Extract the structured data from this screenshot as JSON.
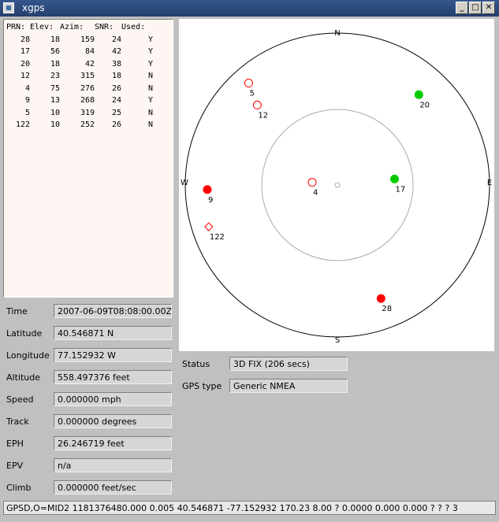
{
  "window": {
    "title": "xgps",
    "minimize_glyph": "_",
    "maximize_glyph": "□",
    "close_glyph": "✕"
  },
  "satellite_table": {
    "headers": [
      "PRN:",
      "Elev:",
      "Azim:",
      "SNR:",
      "Used:"
    ],
    "rows": [
      [
        "28",
        "18",
        "159",
        "24",
        "Y"
      ],
      [
        "17",
        "56",
        "84",
        "42",
        "Y"
      ],
      [
        "20",
        "18",
        "42",
        "38",
        "Y"
      ],
      [
        "12",
        "23",
        "315",
        "18",
        "N"
      ],
      [
        "4",
        "75",
        "276",
        "26",
        "N"
      ],
      [
        "9",
        "13",
        "268",
        "24",
        "Y"
      ],
      [
        "5",
        "10",
        "319",
        "25",
        "N"
      ],
      [
        "122",
        "10",
        "252",
        "26",
        "N"
      ]
    ]
  },
  "skyview": {
    "compass": {
      "north": "N",
      "south": "S",
      "east": "E",
      "west": "W"
    },
    "satellites": [
      {
        "prn": "5",
        "elev": 10,
        "azim": 319,
        "shape": "circle",
        "filled": false,
        "color": "#ff0000"
      },
      {
        "prn": "12",
        "elev": 23,
        "azim": 315,
        "shape": "circle",
        "filled": false,
        "color": "#ff0000"
      },
      {
        "prn": "20",
        "elev": 18,
        "azim": 42,
        "shape": "circle",
        "filled": true,
        "color": "#00cc00"
      },
      {
        "prn": "4",
        "elev": 75,
        "azim": 276,
        "shape": "circle",
        "filled": false,
        "color": "#ff0000"
      },
      {
        "prn": "17",
        "elev": 56,
        "azim": 84,
        "shape": "circle",
        "filled": true,
        "color": "#00cc00"
      },
      {
        "prn": "9",
        "elev": 13,
        "azim": 268,
        "shape": "circle",
        "filled": true,
        "color": "#ff0000"
      },
      {
        "prn": "122",
        "elev": 10,
        "azim": 252,
        "shape": "diamond",
        "filled": false,
        "color": "#ff0000"
      },
      {
        "prn": "28",
        "elev": 18,
        "azim": 159,
        "shape": "circle",
        "filled": true,
        "color": "#ff0000"
      }
    ]
  },
  "fields": {
    "time": {
      "label": "Time",
      "value": "2007-06-09T08:08:00.00Z"
    },
    "latitude": {
      "label": "Latitude",
      "value": "40.546871 N"
    },
    "longitude": {
      "label": "Longitude",
      "value": "77.152932 W"
    },
    "altitude": {
      "label": "Altitude",
      "value": "558.497376 feet"
    },
    "speed": {
      "label": "Speed",
      "value": "0.000000 mph"
    },
    "track": {
      "label": "Track",
      "value": "0.000000 degrees"
    },
    "eph": {
      "label": "EPH",
      "value": "26.246719 feet"
    },
    "epv": {
      "label": "EPV",
      "value": "n/a"
    },
    "climb": {
      "label": "Climb",
      "value": "0.000000 feet/sec"
    },
    "status": {
      "label": "Status",
      "value": "3D FIX (206 secs)"
    },
    "gps_type": {
      "label": "GPS type",
      "value": "Generic NMEA"
    }
  },
  "status_bar": {
    "text": "GPSD,O=MID2 1181376480.000 0.005 40.546871 -77.152932 170.23 8.00 ? 0.0000 0.000 0.000 ? ? ? 3"
  }
}
